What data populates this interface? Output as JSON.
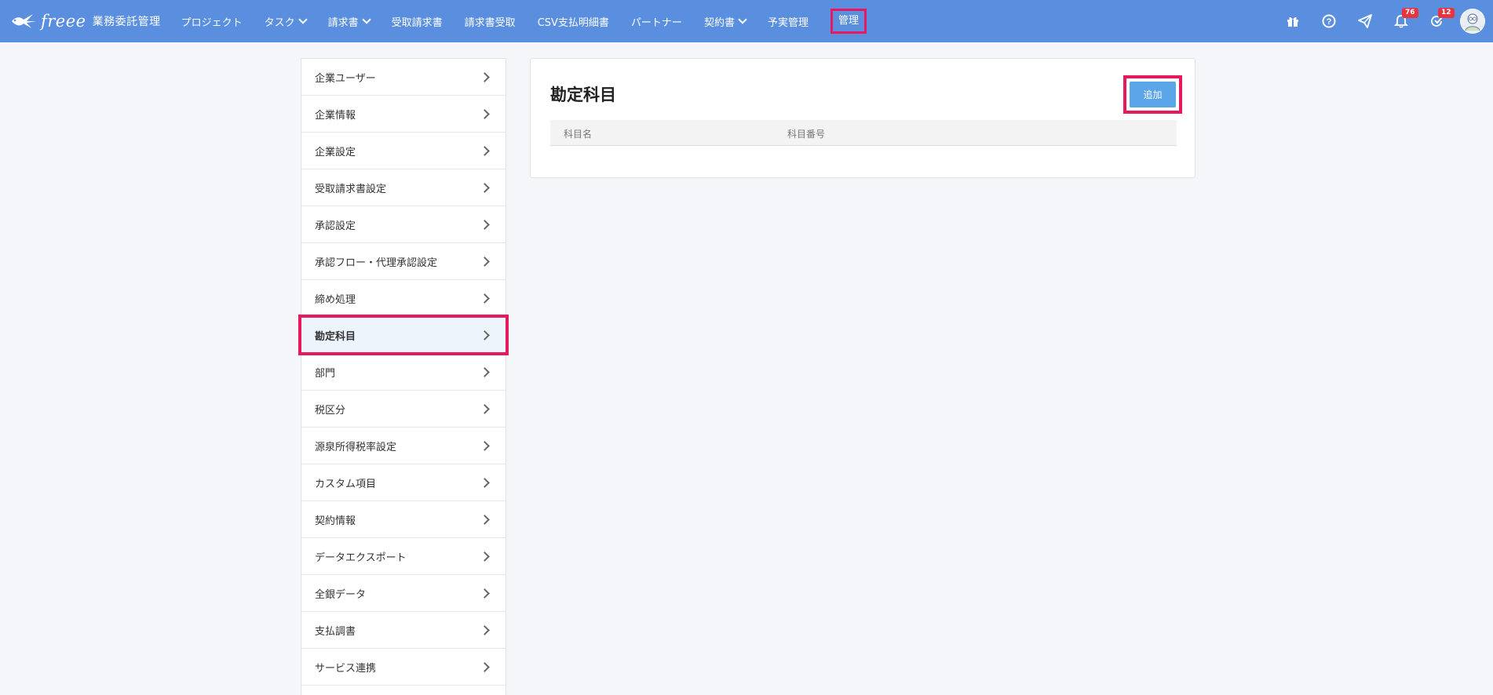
{
  "header": {
    "logo_word": "freee",
    "logo_sub": "業務委託管理",
    "nav": [
      {
        "label": "プロジェクト",
        "has_menu": false
      },
      {
        "label": "タスク",
        "has_menu": true
      },
      {
        "label": "請求書",
        "has_menu": true
      },
      {
        "label": "受取請求書",
        "has_menu": false
      },
      {
        "label": "請求書受取",
        "has_menu": false
      },
      {
        "label": "CSV支払明細書",
        "has_menu": false
      },
      {
        "label": "パートナー",
        "has_menu": false
      },
      {
        "label": "契約書",
        "has_menu": true
      },
      {
        "label": "予実管理",
        "has_menu": false
      }
    ],
    "admin_label": "管理",
    "icons": [
      "gift-icon",
      "help-icon",
      "send-icon",
      "bell-icon",
      "task-check-icon",
      "user-avatar"
    ],
    "notification_count": "76",
    "task_count": "12",
    "colors": {
      "header_bg": "#5a8fe0",
      "highlight": "#e8185e",
      "badge": "#e8343f"
    }
  },
  "sidebar": {
    "items": [
      {
        "label": "企業ユーザー"
      },
      {
        "label": "企業情報"
      },
      {
        "label": "企業設定"
      },
      {
        "label": "受取請求書設定"
      },
      {
        "label": "承認設定"
      },
      {
        "label": "承認フロー・代理承認設定"
      },
      {
        "label": "締め処理"
      },
      {
        "label": "勘定科目"
      },
      {
        "label": "部門"
      },
      {
        "label": "税区分"
      },
      {
        "label": "源泉所得税率設定"
      },
      {
        "label": "カスタム項目"
      },
      {
        "label": "契約情報"
      },
      {
        "label": "データエクスポート"
      },
      {
        "label": "全銀データ"
      },
      {
        "label": "支払調書"
      },
      {
        "label": "サービス連携"
      }
    ],
    "active_index": 7
  },
  "main": {
    "title": "勘定科目",
    "add_label": "追加",
    "columns": [
      "科目名",
      "科目番号"
    ]
  }
}
